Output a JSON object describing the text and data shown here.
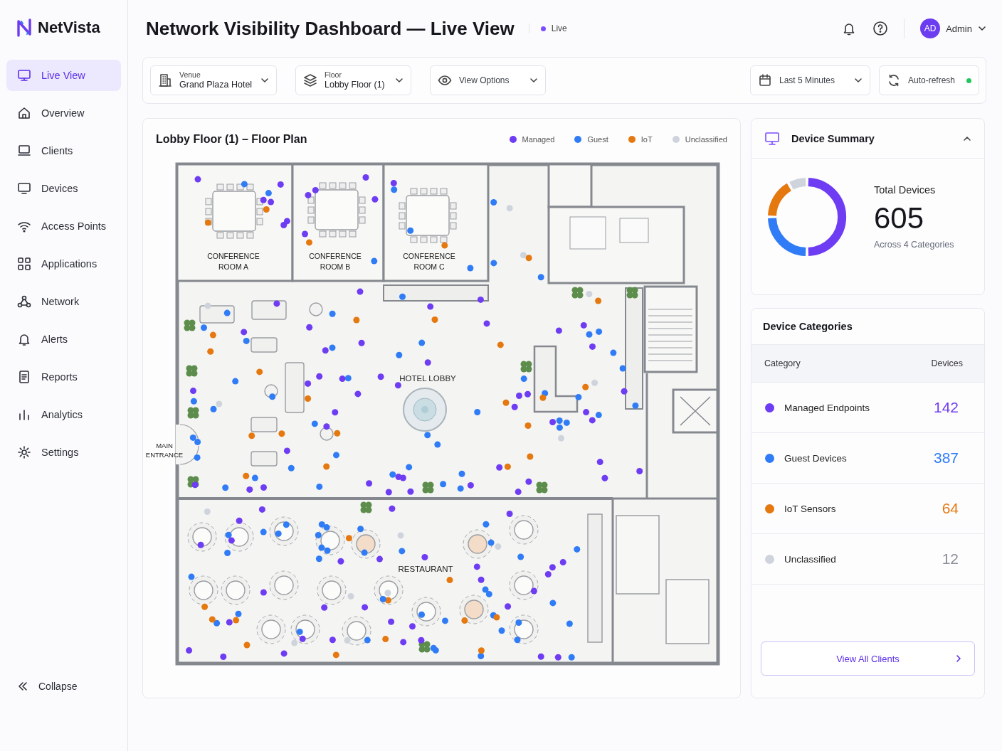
{
  "brand": {
    "name": "NetVista"
  },
  "sidebar": {
    "items": [
      {
        "label": "Live View",
        "selected": true
      },
      {
        "label": "Overview",
        "selected": false
      },
      {
        "label": "Clients",
        "selected": false
      },
      {
        "label": "Devices",
        "selected": false
      },
      {
        "label": "Access Points",
        "selected": false
      },
      {
        "label": "Applications",
        "selected": false
      },
      {
        "label": "Network",
        "selected": false
      },
      {
        "label": "Alerts",
        "selected": false
      },
      {
        "label": "Reports",
        "selected": false
      },
      {
        "label": "Analytics",
        "selected": false
      },
      {
        "label": "Settings",
        "selected": false
      }
    ],
    "collapse": "Collapse"
  },
  "header": {
    "title": "Network Visibility Dashboard — Live View",
    "status": "Live",
    "user": {
      "initials": "AD",
      "name": "Admin"
    }
  },
  "toolbar": {
    "venue": {
      "label": "Venue",
      "value": "Grand Plaza Hotel"
    },
    "floor": {
      "label": "Floor",
      "value": "Lobby Floor (1)"
    },
    "view_options": "View Options",
    "time_range": "Last 5 Minutes",
    "auto_refresh": {
      "label": "Auto-refresh",
      "on": true
    }
  },
  "floor_plan": {
    "title": "Lobby Floor (1) – Floor Plan",
    "legend": [
      {
        "label": "Managed",
        "color": "#6e3cf2"
      },
      {
        "label": "Guest",
        "color": "#2f7cf6"
      },
      {
        "label": "IoT",
        "color": "#e5780f"
      },
      {
        "label": "Unclassified",
        "color": "#cfd4dc"
      }
    ],
    "rooms": [
      {
        "label": "CONFERENCE ROOM A",
        "kind": "room"
      },
      {
        "label": "CONFERENCE ROOM B",
        "kind": "room"
      },
      {
        "label": "CONFERENCE ROOM C",
        "kind": "room"
      },
      {
        "label": "HOTEL LOBBY",
        "kind": "area"
      },
      {
        "label": "MAIN ENTRANCE",
        "kind": "entrance"
      },
      {
        "label": "RESTAURANT",
        "kind": "area"
      }
    ]
  },
  "device_summary": {
    "title": "Device Summary",
    "expanded": true,
    "total_label": "Total Devices",
    "total": "605",
    "caption": "Across 4 Categories"
  },
  "device_categories": {
    "title": "Device Categories",
    "columns": [
      "Category",
      "Devices"
    ],
    "rows": [
      {
        "name": "Managed Endpoints",
        "count": "142",
        "color": "#6e3cf2"
      },
      {
        "name": "Guest Devices",
        "count": "387",
        "color": "#2f7cf6"
      },
      {
        "name": "IoT Sensors",
        "count": "64",
        "color": "#e5780f"
      },
      {
        "name": "Unclassified",
        "count": "12",
        "color": "#cfd4dc"
      }
    ],
    "button": "View All Clients"
  }
}
